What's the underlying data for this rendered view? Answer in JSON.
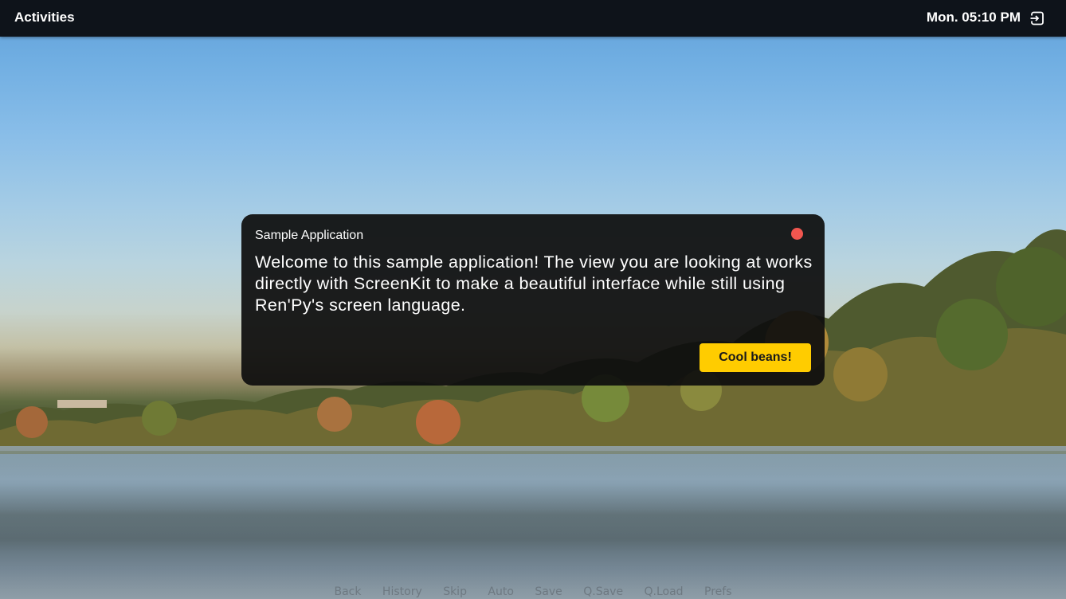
{
  "topbar": {
    "activities_label": "Activities",
    "clock": "Mon. 05:10 PM",
    "logout_icon": "logout-icon"
  },
  "dialog": {
    "title": "Sample Application",
    "body": "Welcome to this sample application! The view you are looking at works directly with ScreenKit to make a beautiful interface while still using Ren'Py's screen language.",
    "confirm_label": "Cool beans!",
    "close_color": "#f0564f",
    "accent_color": "#ffcc00"
  },
  "quick_menu": {
    "items": [
      "Back",
      "History",
      "Skip",
      "Auto",
      "Save",
      "Q.Save",
      "Q.Load",
      "Prefs"
    ]
  },
  "background": {
    "scene": "lake-autumn-trees",
    "sky_color": "#6aa8df"
  }
}
